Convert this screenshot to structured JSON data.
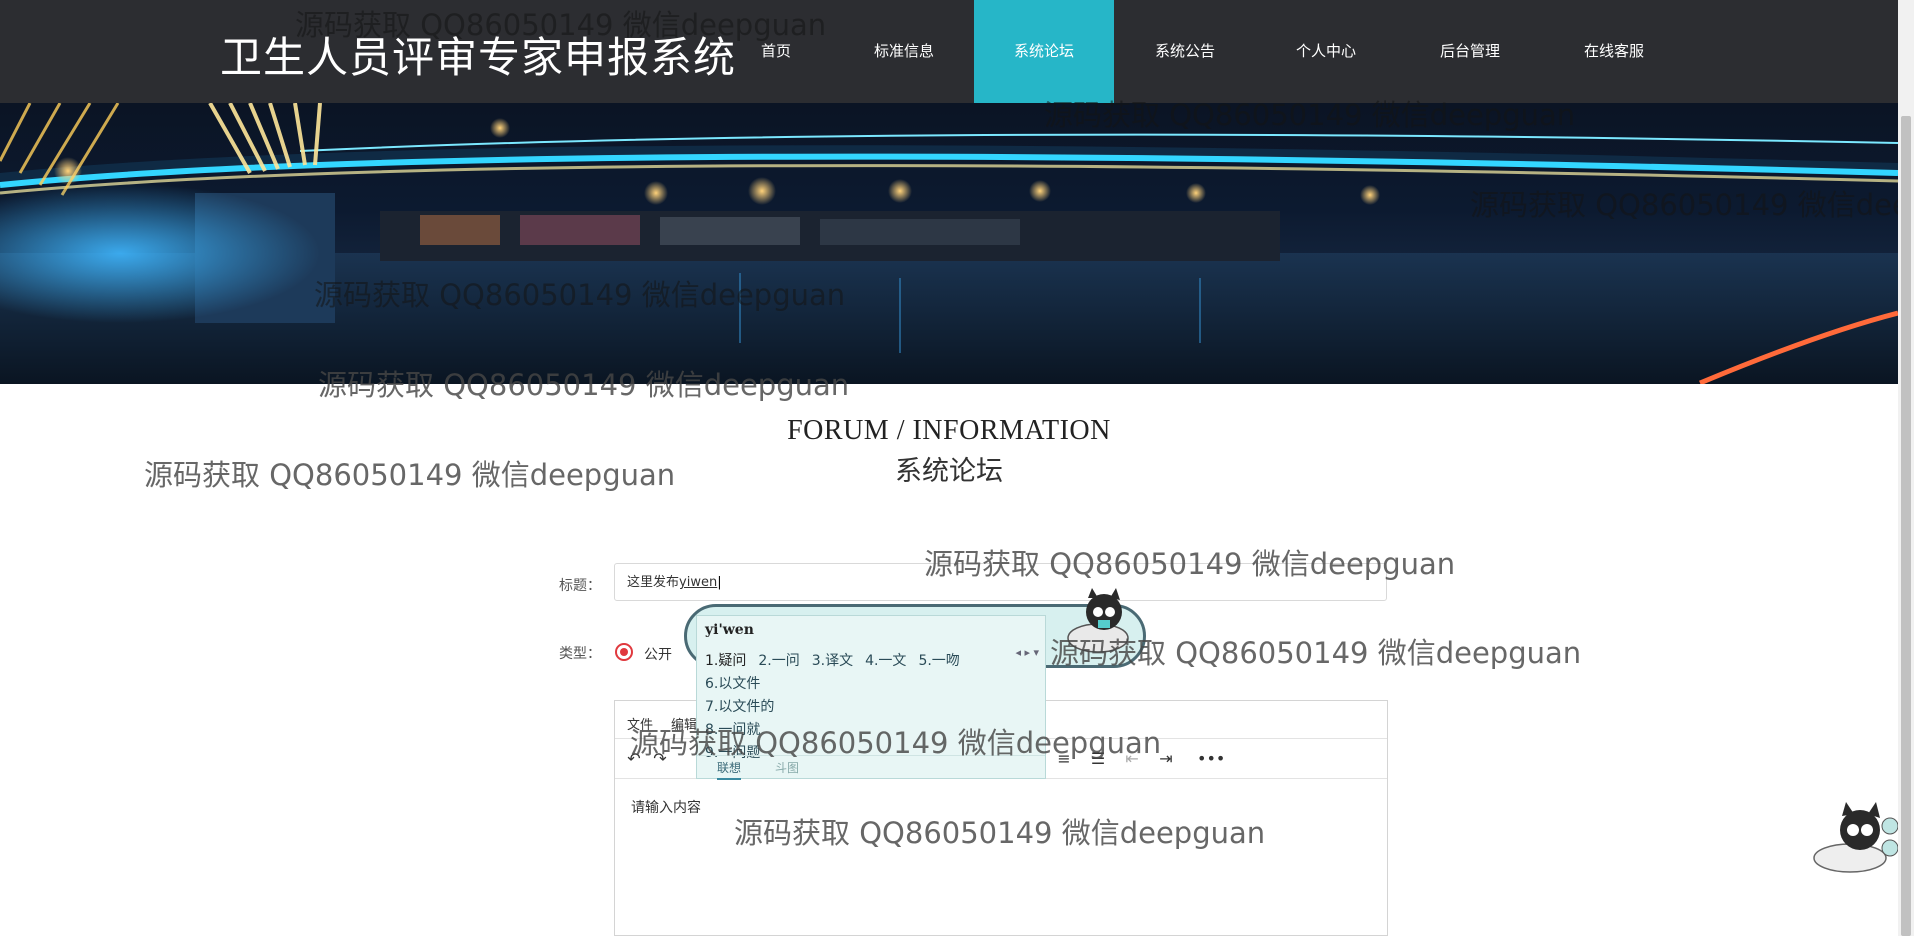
{
  "site": {
    "title": "卫生人员评审专家申报系统"
  },
  "nav": {
    "items": [
      {
        "label": "首页"
      },
      {
        "label": "标准信息"
      },
      {
        "label": "系统论坛"
      },
      {
        "label": "系统公告"
      },
      {
        "label": "个人中心"
      },
      {
        "label": "后台管理"
      },
      {
        "label": "在线客服"
      }
    ],
    "active_index": 2,
    "active_color": "#26b6c8"
  },
  "section": {
    "english": "FORUM / INFORMATION",
    "chinese": "系统论坛"
  },
  "form": {
    "title_label": "标题：",
    "title_value_prefix": "这里发布",
    "title_value_typed": "yiwen",
    "type_label": "类型：",
    "type_option": "公开"
  },
  "editor": {
    "menu": [
      "文件",
      "编辑"
    ],
    "placeholder": "请输入内容"
  },
  "ime": {
    "pinyin": "yi'wen",
    "candidates_row1": [
      "1.疑问",
      "2.一问",
      "3.译文",
      "4.一文",
      "5.一吻"
    ],
    "candidates_more": [
      "6.以文件",
      "7.以文件的",
      "8.一问就",
      "9.一问题"
    ],
    "tabs": [
      "联想",
      "斗图"
    ]
  },
  "watermark": "源码获取 QQ86050149 微信deepguan",
  "colors": {
    "navbar_bg": "#2c2d31",
    "accent": "#26b6c8",
    "radio_red": "#e0393e"
  }
}
